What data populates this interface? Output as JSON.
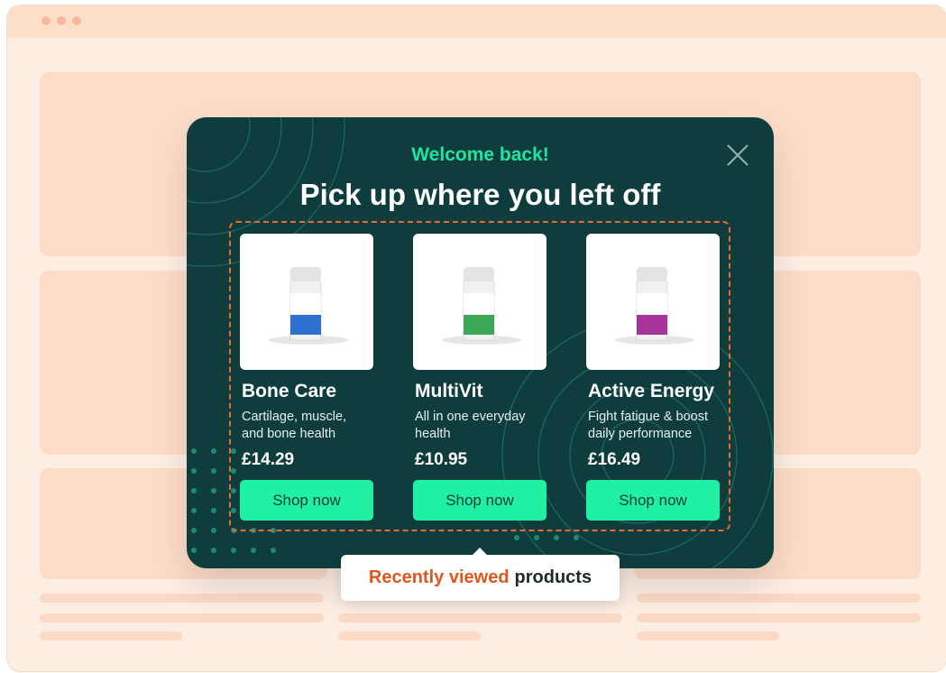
{
  "popup": {
    "welcome": "Welcome back!",
    "headline": "Pick up where you left off",
    "products": [
      {
        "name": "Bone Care",
        "desc_line1": "Cartilage, muscle,",
        "desc_line2": "and bone health",
        "price": "£14.29",
        "button": "Shop now",
        "label_color": "#2f6fd0"
      },
      {
        "name": "MultiVit",
        "desc_line1": "All in one everyday",
        "desc_line2": "health",
        "price": "£10.95",
        "button": "Shop now",
        "label_color": "#3aa857"
      },
      {
        "name": "Active Energy",
        "desc_line1": "Fight fatigue & boost",
        "desc_line2": "daily performance",
        "price": "£16.49",
        "button": "Shop now",
        "label_color": "#a8339b"
      }
    ]
  },
  "tooltip": {
    "accent": "Recently viewed",
    "rest": "products"
  },
  "colors": {
    "popup_bg": "#0f3d3e",
    "accent_green": "#1ee5a0",
    "button_green": "#1ff0a4",
    "accent_orange": "#e0571d",
    "page_bg": "#fdeee4"
  }
}
